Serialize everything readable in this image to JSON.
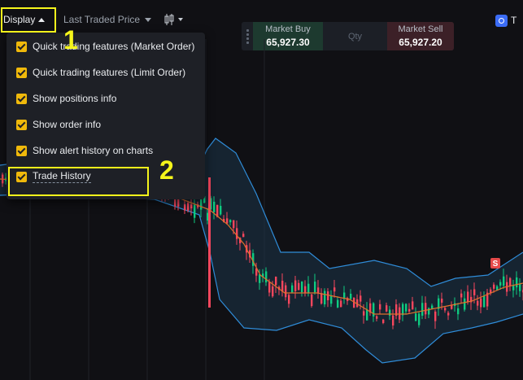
{
  "toolbar": {
    "display_label": "Display",
    "price_type_label": "Last Traded Price",
    "candle_icon": "candlestick-icon",
    "right_truncated_text": "T"
  },
  "trade_panel": {
    "market_buy_label": "Market Buy",
    "market_buy_price": "65,927.30",
    "qty_placeholder": "Qty",
    "market_sell_label": "Market Sell",
    "market_sell_price": "65,927.20"
  },
  "display_menu": {
    "items": [
      {
        "label": "Quick trading features (Market Order)",
        "checked": true
      },
      {
        "label": "Quick trading features (Limit Order)",
        "checked": true
      },
      {
        "label": "Show positions info",
        "checked": true
      },
      {
        "label": "Show order info",
        "checked": true
      },
      {
        "label": "Show alert history on charts",
        "checked": true
      },
      {
        "label": "Trade History",
        "checked": true
      }
    ]
  },
  "annotations": {
    "step1": "1",
    "step2": "2"
  },
  "chart": {
    "sell_marker": "S",
    "colors": {
      "up": "#0ecb81",
      "down": "#f6465d",
      "band": "#2f8cd8",
      "ma": "#e0712c",
      "highlight": "#f5f51b",
      "accent": "#f0b90b"
    }
  }
}
